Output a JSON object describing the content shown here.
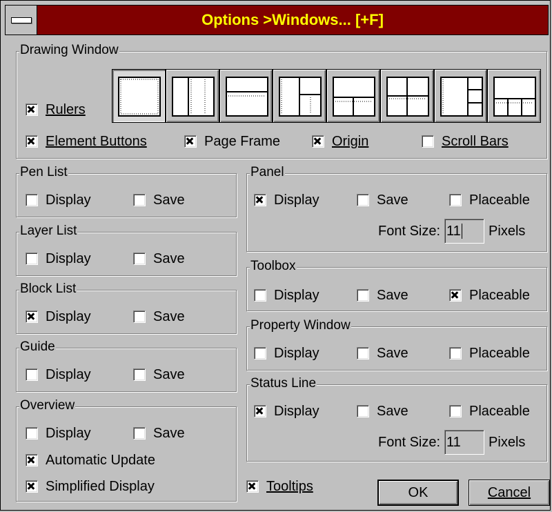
{
  "window": {
    "title": "Options >Windows... [+F]"
  },
  "drawing_window": {
    "legend": "Drawing Window",
    "rulers": {
      "label": "Rulers",
      "checked": true
    },
    "element_buttons": {
      "label": "Element Buttons",
      "checked": true
    },
    "page_frame": {
      "label": "Page Frame",
      "checked": true
    },
    "origin": {
      "label": "Origin",
      "checked": true
    },
    "scroll_bars": {
      "label": "Scroll Bars",
      "checked": false
    },
    "layouts": [
      "single",
      "vertical-split",
      "horizontal-split",
      "left-and-right-split",
      "top-and-bottom-split",
      "quad",
      "left-and-three-right",
      "top-and-three-bottom"
    ],
    "selected_layout": 0
  },
  "pen_list": {
    "legend": "Pen List",
    "display": {
      "label": "Display",
      "checked": false
    },
    "save": {
      "label": "Save",
      "checked": false
    }
  },
  "layer_list": {
    "legend": "Layer List",
    "display": {
      "label": "Display",
      "checked": false
    },
    "save": {
      "label": "Save",
      "checked": false
    }
  },
  "block_list": {
    "legend": "Block List",
    "display": {
      "label": "Display",
      "checked": true
    },
    "save": {
      "label": "Save",
      "checked": false
    }
  },
  "guide": {
    "legend": "Guide",
    "display": {
      "label": "Display",
      "checked": false
    },
    "save": {
      "label": "Save",
      "checked": false
    }
  },
  "overview": {
    "legend": "Overview",
    "display": {
      "label": "Display",
      "checked": false
    },
    "save": {
      "label": "Save",
      "checked": false
    },
    "automatic_update": {
      "label": "Automatic Update",
      "checked": true
    },
    "simplified_display": {
      "label": "Simplified Display",
      "checked": true
    }
  },
  "panel": {
    "legend": "Panel",
    "display": {
      "label": "Display",
      "checked": true
    },
    "save": {
      "label": "Save",
      "checked": false
    },
    "placeable": {
      "label": "Placeable",
      "checked": false
    },
    "font_size_label": "Font Size:",
    "font_size_value": "11",
    "font_size_unit": "Pixels"
  },
  "toolbox": {
    "legend": "Toolbox",
    "display": {
      "label": "Display",
      "checked": false
    },
    "save": {
      "label": "Save",
      "checked": false
    },
    "placeable": {
      "label": "Placeable",
      "checked": true
    }
  },
  "property_window": {
    "legend": "Property Window",
    "display": {
      "label": "Display",
      "checked": false
    },
    "save": {
      "label": "Save",
      "checked": false
    },
    "placeable": {
      "label": "Placeable",
      "checked": false
    }
  },
  "status_line": {
    "legend": "Status Line",
    "display": {
      "label": "Display",
      "checked": true
    },
    "save": {
      "label": "Save",
      "checked": false
    },
    "placeable": {
      "label": "Placeable",
      "checked": false
    },
    "font_size_label": "Font Size:",
    "font_size_value": "11",
    "font_size_unit": "Pixels"
  },
  "tooltips": {
    "label": "Tooltips",
    "checked": true
  },
  "buttons": {
    "ok": "OK",
    "cancel": "Cancel"
  }
}
